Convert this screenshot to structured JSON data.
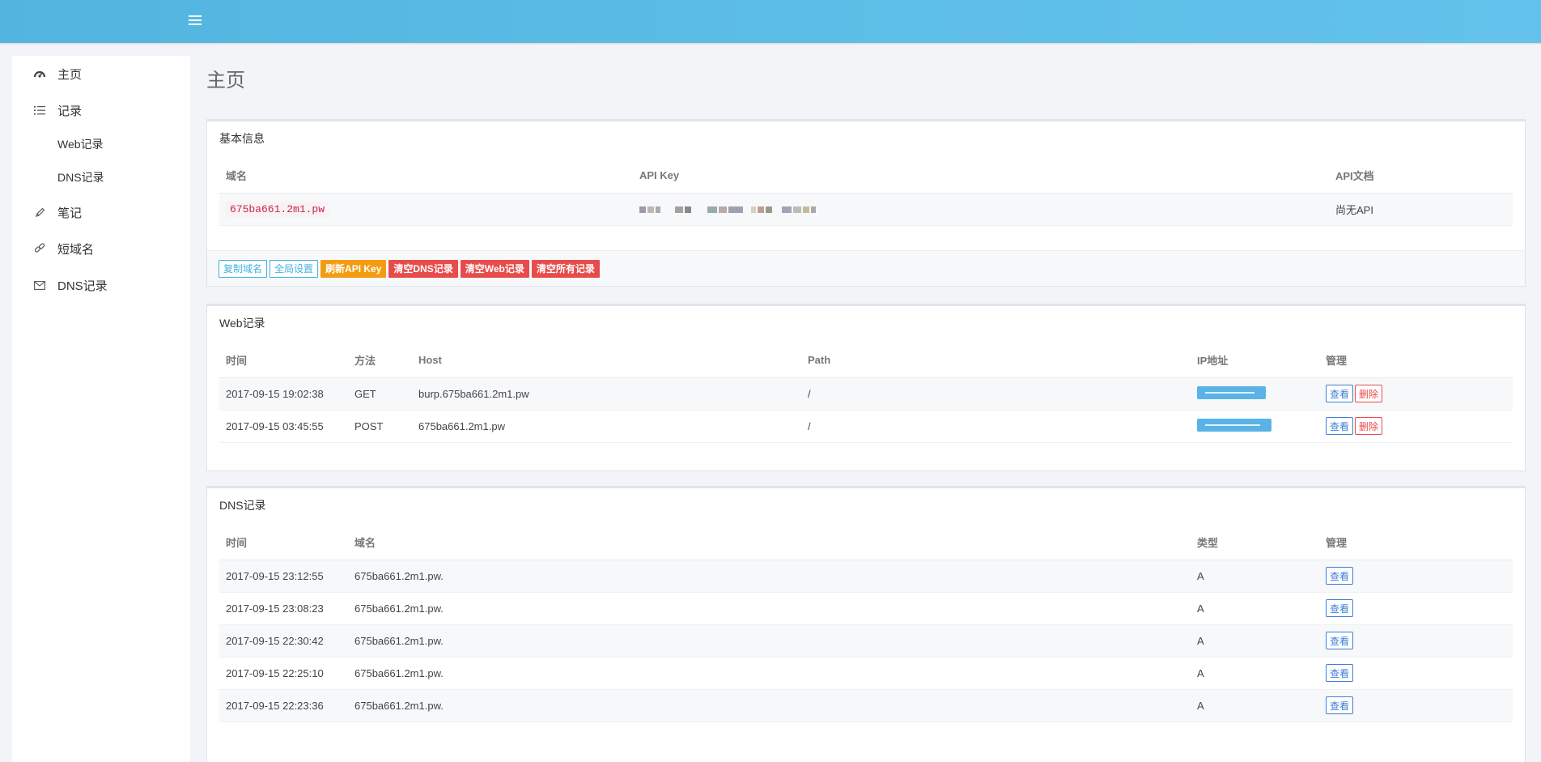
{
  "topbar": {
    "menu_icon": "hamburger-icon"
  },
  "sidebar": {
    "items": [
      {
        "label": "主页",
        "icon": "dashboard-icon"
      },
      {
        "label": "记录",
        "icon": "list-icon"
      },
      {
        "label": "Web记录",
        "icon": ""
      },
      {
        "label": "DNS记录",
        "icon": ""
      },
      {
        "label": "笔记",
        "icon": "pencil-icon"
      },
      {
        "label": "短域名",
        "icon": "link-icon"
      },
      {
        "label": "DNS记录",
        "icon": "envelope-icon"
      }
    ]
  },
  "page": {
    "title": "主页"
  },
  "basic_info": {
    "title": "基本信息",
    "headers": [
      "域名",
      "API Key",
      "API文档"
    ],
    "domain": "675ba661.2m1.pw",
    "api_doc": "尚无API",
    "buttons": {
      "copy_domain": "复制域名",
      "global_settings": "全局设置",
      "refresh_api_key": "刷新API Key",
      "clear_dns": "清空DNS记录",
      "clear_web": "清空Web记录",
      "clear_all": "清空所有记录"
    }
  },
  "web_records": {
    "title": "Web记录",
    "headers": [
      "时间",
      "方法",
      "Host",
      "Path",
      "IP地址",
      "管理"
    ],
    "rows": [
      {
        "time": "2017-09-15 19:02:38",
        "method": "GET",
        "host": "burp.675ba661.2m1.pw",
        "path": "/"
      },
      {
        "time": "2017-09-15 03:45:55",
        "method": "POST",
        "host": "675ba661.2m1.pw",
        "path": "/"
      }
    ],
    "view_label": "查看",
    "delete_label": "删除"
  },
  "dns_records": {
    "title": "DNS记录",
    "headers": [
      "时间",
      "域名",
      "类型",
      "管理"
    ],
    "rows": [
      {
        "time": "2017-09-15 23:12:55",
        "domain": "675ba661.2m1.pw.",
        "type": "A"
      },
      {
        "time": "2017-09-15 23:08:23",
        "domain": "675ba661.2m1.pw.",
        "type": "A"
      },
      {
        "time": "2017-09-15 22:30:42",
        "domain": "675ba661.2m1.pw.",
        "type": "A"
      },
      {
        "time": "2017-09-15 22:25:10",
        "domain": "675ba661.2m1.pw.",
        "type": "A"
      },
      {
        "time": "2017-09-15 22:23:36",
        "domain": "675ba661.2m1.pw.",
        "type": "A"
      }
    ],
    "view_label": "查看"
  },
  "colors": {
    "topbar": "#5cbde6",
    "info": "#44b3e1",
    "warning": "#f39c12",
    "danger": "#e74c4b",
    "view": "#3c7fd8"
  }
}
